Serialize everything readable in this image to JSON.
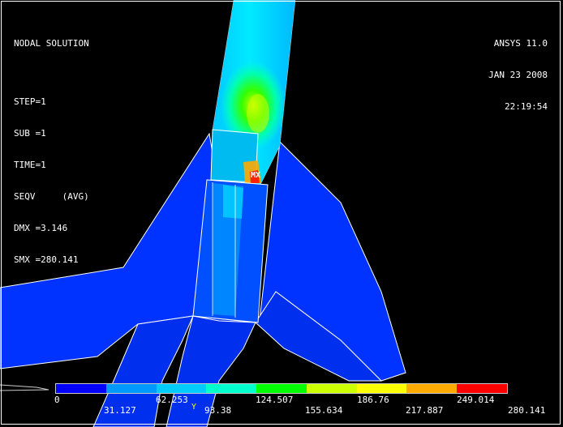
{
  "info": {
    "title": "NODAL SOLUTION",
    "step": "STEP=1",
    "sub": "SUB =1",
    "time": "TIME=1",
    "result": "SEQV     (AVG)",
    "dmx": "DMX =3.146",
    "smx": "SMX =280.141"
  },
  "header_right": {
    "product": "ANSYS 11.0",
    "date": "JAN 23 2008",
    "time": "22:19:54"
  },
  "markers": {
    "max": "MX",
    "triad_y": "Y"
  },
  "legend": {
    "colors": [
      "#0000ff",
      "#0099ff",
      "#00ccff",
      "#00ffcc",
      "#00ff00",
      "#ccff00",
      "#ffff00",
      "#ffaa00",
      "#ff0000"
    ],
    "top_labels": [
      "0",
      "62.253",
      "124.507",
      "186.76",
      "249.014"
    ],
    "bottom_labels": [
      "31.127",
      "93.38",
      "155.634",
      "217.887",
      "280.141"
    ]
  }
}
